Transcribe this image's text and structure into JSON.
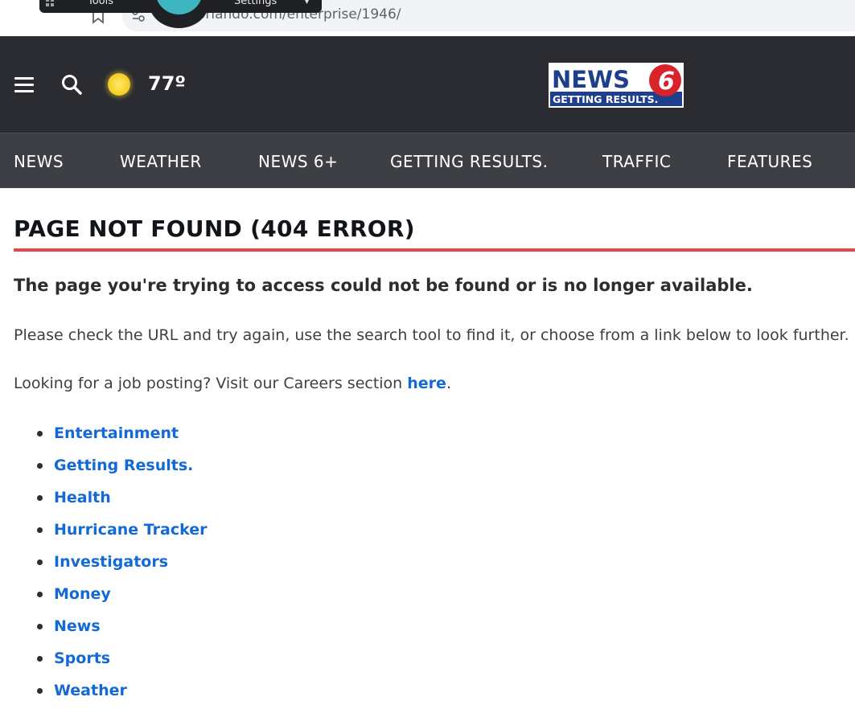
{
  "browser": {
    "url": "orlando.com/enterprise/1946/",
    "overlay": {
      "tools_label": "Tools",
      "settings_label": "Settings"
    }
  },
  "header": {
    "temperature": "77º",
    "logo": {
      "line1": "NEWS",
      "number": "6",
      "line2": "GETTING RESULTS."
    }
  },
  "nav": {
    "items": [
      "NEWS",
      "WEATHER",
      "NEWS 6+",
      "GETTING RESULTS.",
      "TRAFFIC",
      "FEATURES"
    ]
  },
  "content": {
    "title": "PAGE NOT FOUND (404 ERROR)",
    "subhead": "The page you're trying to access could not be found or is no longer available.",
    "paragraph1": "Please check the URL and try again, use the search tool to find it, or choose from a link below to look further.",
    "careers_prefix": "Looking for a job posting? Visit our Careers section ",
    "careers_link": "here",
    "careers_suffix": ".",
    "links": [
      "Entertainment",
      "Getting Results.",
      "Health",
      "Hurricane Tracker",
      "Investigators",
      "Money",
      "News",
      "Sports",
      "Weather"
    ]
  },
  "colors": {
    "header_bg": "#2a2c31",
    "nav_bg": "#3d3f44",
    "accent_red": "#e44a4d",
    "link_blue": "#1369d6"
  }
}
